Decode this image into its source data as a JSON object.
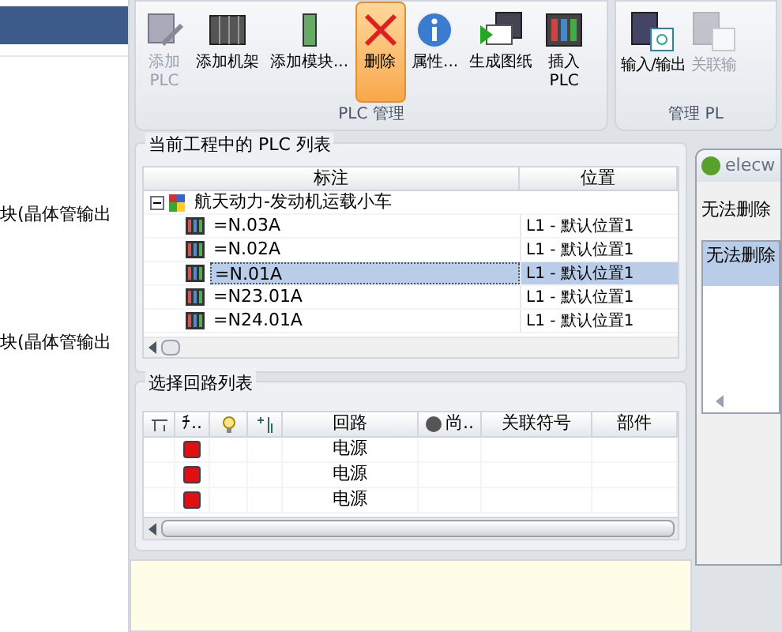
{
  "left_panel": {
    "items": [
      "块(晶体管输出",
      "块(晶体管输出"
    ]
  },
  "ribbon": {
    "groups": [
      {
        "label": "PLC 管理",
        "buttons": [
          {
            "label": "添加\nPLC",
            "kind": "add-plc",
            "disabled": true,
            "selected": false
          },
          {
            "label": "添加机架",
            "kind": "rack",
            "disabled": false,
            "selected": false
          },
          {
            "label": "添加模块...",
            "kind": "module",
            "disabled": false,
            "selected": false
          },
          {
            "label": "删除",
            "kind": "delete",
            "disabled": false,
            "selected": true
          },
          {
            "label": "属性...",
            "kind": "info",
            "disabled": false,
            "selected": false
          },
          {
            "label": "生成图纸",
            "kind": "drawing",
            "disabled": false,
            "selected": false
          },
          {
            "label": "插入\nPLC",
            "kind": "insert",
            "disabled": false,
            "selected": false
          }
        ]
      },
      {
        "label": "管理 PL",
        "buttons": [
          {
            "label": "输入/输出",
            "kind": "io",
            "disabled": false,
            "selected": false
          },
          {
            "label": "关联输",
            "kind": "link",
            "disabled": true,
            "selected": false
          }
        ]
      }
    ]
  },
  "plc_list": {
    "title": "当前工程中的 PLC 列表",
    "columns": [
      "标注",
      "位置"
    ],
    "root": {
      "label": "航天动力-发动机运载小车",
      "expanded": true,
      "children": [
        {
          "label": "=N.03A",
          "location": "L1 - 默认位置1",
          "selected": false
        },
        {
          "label": "=N.02A",
          "location": "L1 - 默认位置1",
          "selected": false
        },
        {
          "label": "=N.01A",
          "location": "L1 - 默认位置1",
          "selected": true
        },
        {
          "label": "=N23.01A",
          "location": "L1 - 默认位置1",
          "selected": false
        },
        {
          "label": "=N24.01A",
          "location": "L1 - 默认位置1",
          "selected": false
        }
      ]
    }
  },
  "circuit_list": {
    "title": "选择回路列表",
    "columns": [
      {
        "kind": "icon-wire"
      },
      {
        "kind": "text",
        "label": "ﾁ.."
      },
      {
        "kind": "icon-bulb"
      },
      {
        "kind": "icon-terminal"
      },
      {
        "kind": "text",
        "label": "回路"
      },
      {
        "kind": "icon-ball",
        "label": "尚.."
      },
      {
        "kind": "text",
        "label": "关联符号"
      },
      {
        "kind": "text",
        "label": "部件"
      }
    ],
    "rows": [
      {
        "color": "#e01010",
        "circuit": "电源"
      },
      {
        "color": "#e01010",
        "circuit": "电源"
      },
      {
        "color": "#e01010",
        "circuit": "电源"
      }
    ]
  },
  "dialog": {
    "title": "elecw",
    "message": "无法删除",
    "list": [
      {
        "text": "无法删除",
        "selected": true
      }
    ]
  }
}
